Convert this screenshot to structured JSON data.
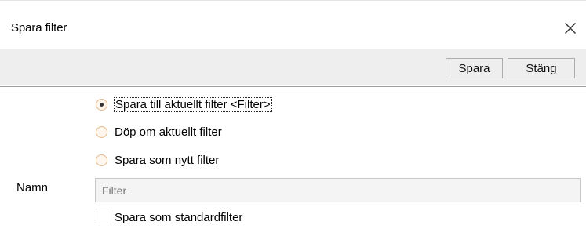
{
  "dialog": {
    "title": "Spara filter",
    "close_icon": "close-icon",
    "toolbar": {
      "save_label": "Spara",
      "close_label": "Stäng"
    },
    "options": [
      {
        "label": "Spara till aktuellt filter <Filter>",
        "selected": true
      },
      {
        "label": "Döp om aktuellt filter",
        "selected": false
      },
      {
        "label": "Spara som nytt filter",
        "selected": false
      }
    ],
    "name": {
      "label": "Namn",
      "placeholder": "Filter"
    },
    "default_checkbox": {
      "label": "Spara som standardfilter",
      "checked": false
    }
  }
}
